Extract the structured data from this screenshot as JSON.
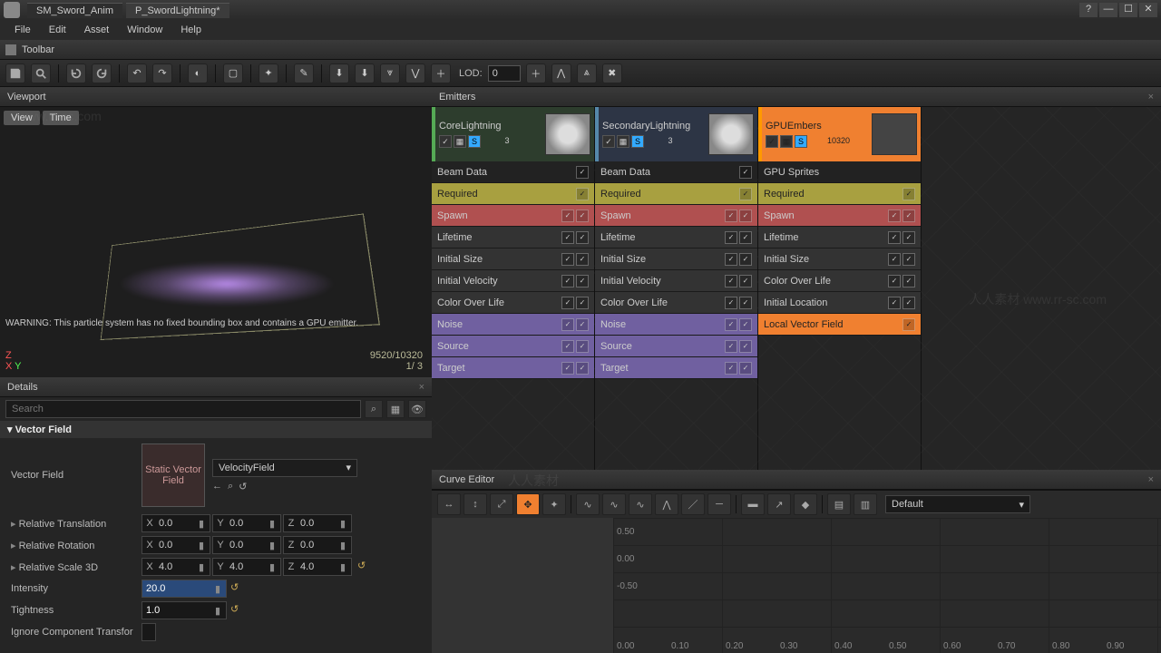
{
  "titlebar": {
    "tabs": [
      "SM_Sword_Anim",
      "P_SwordLightning*"
    ],
    "active_tab": 1
  },
  "menubar": {
    "items": [
      "File",
      "Edit",
      "Asset",
      "Window",
      "Help"
    ]
  },
  "toolbar_label": "Toolbar",
  "lod": {
    "label": "LOD:",
    "value": "0"
  },
  "viewport": {
    "tab": "Viewport",
    "buttons": [
      "View",
      "Time"
    ],
    "warning": "WARNING: This particle system has no fixed bounding box and contains a GPU emitter.",
    "stats": {
      "line1": "9520/10320",
      "line2": "1/  3"
    },
    "axis": [
      "Z",
      "X",
      "Y"
    ]
  },
  "details": {
    "tab": "Details",
    "search_placeholder": "Search",
    "category": "Vector Field",
    "vf_label": "Vector Field",
    "vf_slot": "Static Vector Field",
    "vf_asset": "VelocityField",
    "rows": {
      "rel_trans": {
        "label": "Relative Translation",
        "x": "0.0",
        "y": "0.0",
        "z": "0.0"
      },
      "rel_rot": {
        "label": "Relative Rotation",
        "x": "0.0",
        "y": "0.0",
        "z": "0.0"
      },
      "rel_scale": {
        "label": "Relative Scale 3D",
        "x": "4.0",
        "y": "4.0",
        "z": "4.0"
      },
      "intensity": {
        "label": "Intensity",
        "value": "20.0"
      },
      "tightness": {
        "label": "Tightness",
        "value": "1.0"
      },
      "ignore": {
        "label": "Ignore Component Transfor"
      }
    }
  },
  "emitters": {
    "tab": "Emitters",
    "columns": [
      {
        "name": "CoreLightning",
        "count": "3",
        "color": "green",
        "thumb": "light",
        "modules": [
          {
            "label": "Beam Data",
            "bg": "black",
            "checks": 1
          },
          {
            "label": "Required",
            "bg": "yellow",
            "checks": 1
          },
          {
            "label": "Spawn",
            "bg": "red",
            "checks": 2
          },
          {
            "label": "Lifetime",
            "bg": "default",
            "checks": 2
          },
          {
            "label": "Initial Size",
            "bg": "default",
            "checks": 2
          },
          {
            "label": "Initial Velocity",
            "bg": "default",
            "checks": 2
          },
          {
            "label": "Color Over Life",
            "bg": "default",
            "checks": 2
          },
          {
            "label": "Noise",
            "bg": "purple",
            "checks": 2
          },
          {
            "label": "Source",
            "bg": "purple",
            "checks": 2
          },
          {
            "label": "Target",
            "bg": "purple",
            "checks": 2
          }
        ]
      },
      {
        "name": "SecondaryLightning",
        "count": "3",
        "color": "blue",
        "thumb": "light",
        "modules": [
          {
            "label": "Beam Data",
            "bg": "black",
            "checks": 1
          },
          {
            "label": "Required",
            "bg": "yellow",
            "checks": 1
          },
          {
            "label": "Spawn",
            "bg": "red",
            "checks": 2
          },
          {
            "label": "Lifetime",
            "bg": "default",
            "checks": 2
          },
          {
            "label": "Initial Size",
            "bg": "default",
            "checks": 2
          },
          {
            "label": "Initial Velocity",
            "bg": "default",
            "checks": 2
          },
          {
            "label": "Color Over Life",
            "bg": "default",
            "checks": 2
          },
          {
            "label": "Noise",
            "bg": "purple",
            "checks": 2
          },
          {
            "label": "Source",
            "bg": "purple",
            "checks": 2
          },
          {
            "label": "Target",
            "bg": "purple",
            "checks": 2
          }
        ]
      },
      {
        "name": "GPUEmbers",
        "count": "10320",
        "color": "orange",
        "thumb": "dark",
        "modules": [
          {
            "label": "GPU Sprites",
            "bg": "black",
            "checks": 0
          },
          {
            "label": "Required",
            "bg": "yellow",
            "checks": 1
          },
          {
            "label": "Spawn",
            "bg": "red",
            "checks": 2
          },
          {
            "label": "Lifetime",
            "bg": "default",
            "checks": 2
          },
          {
            "label": "Initial Size",
            "bg": "default",
            "checks": 2
          },
          {
            "label": "Color Over Life",
            "bg": "default",
            "checks": 2
          },
          {
            "label": "Initial Location",
            "bg": "default",
            "checks": 2
          },
          {
            "label": "Local Vector Field",
            "bg": "orange",
            "checks": 1
          }
        ]
      }
    ]
  },
  "curve": {
    "tab": "Curve Editor",
    "dropdown": "Default",
    "y_labels": [
      "0.50",
      "0.00",
      "-0.50"
    ],
    "x_labels": [
      "0.00",
      "0.10",
      "0.20",
      "0.30",
      "0.40",
      "0.50",
      "0.60",
      "0.70",
      "0.80",
      "0.90"
    ]
  },
  "watermarks": [
    "www.rr-sc.com",
    "人人素材",
    "www.rr-sc.com",
    "人人素材 www.rr-sc.com"
  ]
}
